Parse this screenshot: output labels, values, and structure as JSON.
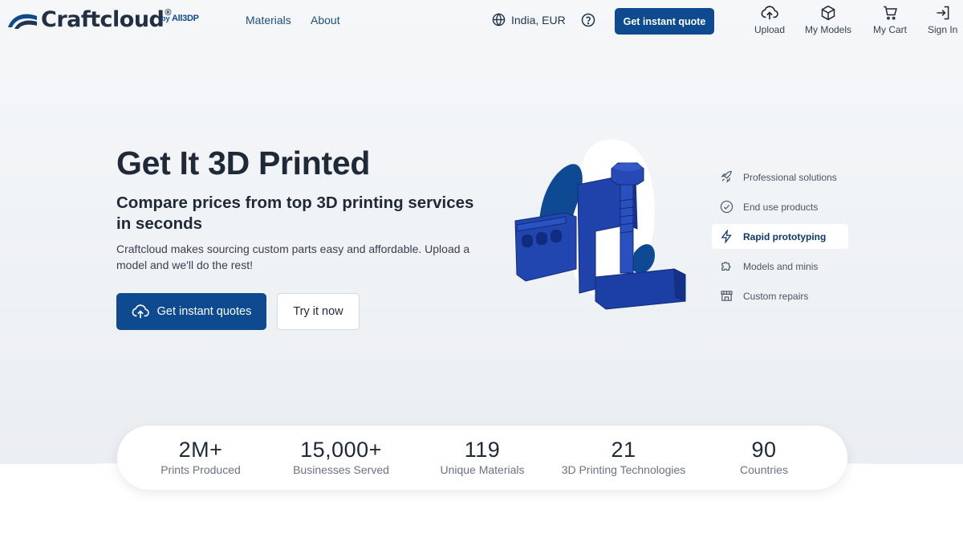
{
  "brand": {
    "name": "Craftcloud",
    "registered": "®",
    "by_prefix": "by",
    "by_name": "All3DP",
    "color": "#0d4a8f"
  },
  "nav": {
    "links": [
      "Materials",
      "About"
    ],
    "region": "India, EUR",
    "quote_button": "Get instant quote",
    "icons": [
      {
        "label": "Upload",
        "icon": "upload-cloud-icon"
      },
      {
        "label": "My Models",
        "icon": "cube-icon"
      },
      {
        "label": "My Cart",
        "icon": "cart-icon"
      },
      {
        "label": "Sign In",
        "icon": "sign-in-icon"
      }
    ]
  },
  "hero": {
    "title": "Get It 3D Printed",
    "subtitle": "Compare prices from top 3D printing services in seconds",
    "description": "Craftcloud makes sourcing custom parts easy and affordable. Upload a model and we'll do the rest!",
    "primary_button": "Get instant quotes",
    "secondary_button": "Try it now"
  },
  "use_cases": [
    {
      "label": "Professional solutions",
      "icon": "rocket-icon",
      "active": false
    },
    {
      "label": "End use products",
      "icon": "check-circle-icon",
      "active": false
    },
    {
      "label": "Rapid prototyping",
      "icon": "lightning-icon",
      "active": true
    },
    {
      "label": "Models and minis",
      "icon": "puzzle-icon",
      "active": false
    },
    {
      "label": "Custom repairs",
      "icon": "storefront-icon",
      "active": false
    }
  ],
  "stats": [
    {
      "value": "2M+",
      "label": "Prints Produced"
    },
    {
      "value": "15,000+",
      "label": "Businesses Served"
    },
    {
      "value": "119",
      "label": "Unique Materials"
    },
    {
      "value": "21",
      "label": "3D Printing Technologies"
    },
    {
      "value": "90",
      "label": "Countries"
    }
  ]
}
